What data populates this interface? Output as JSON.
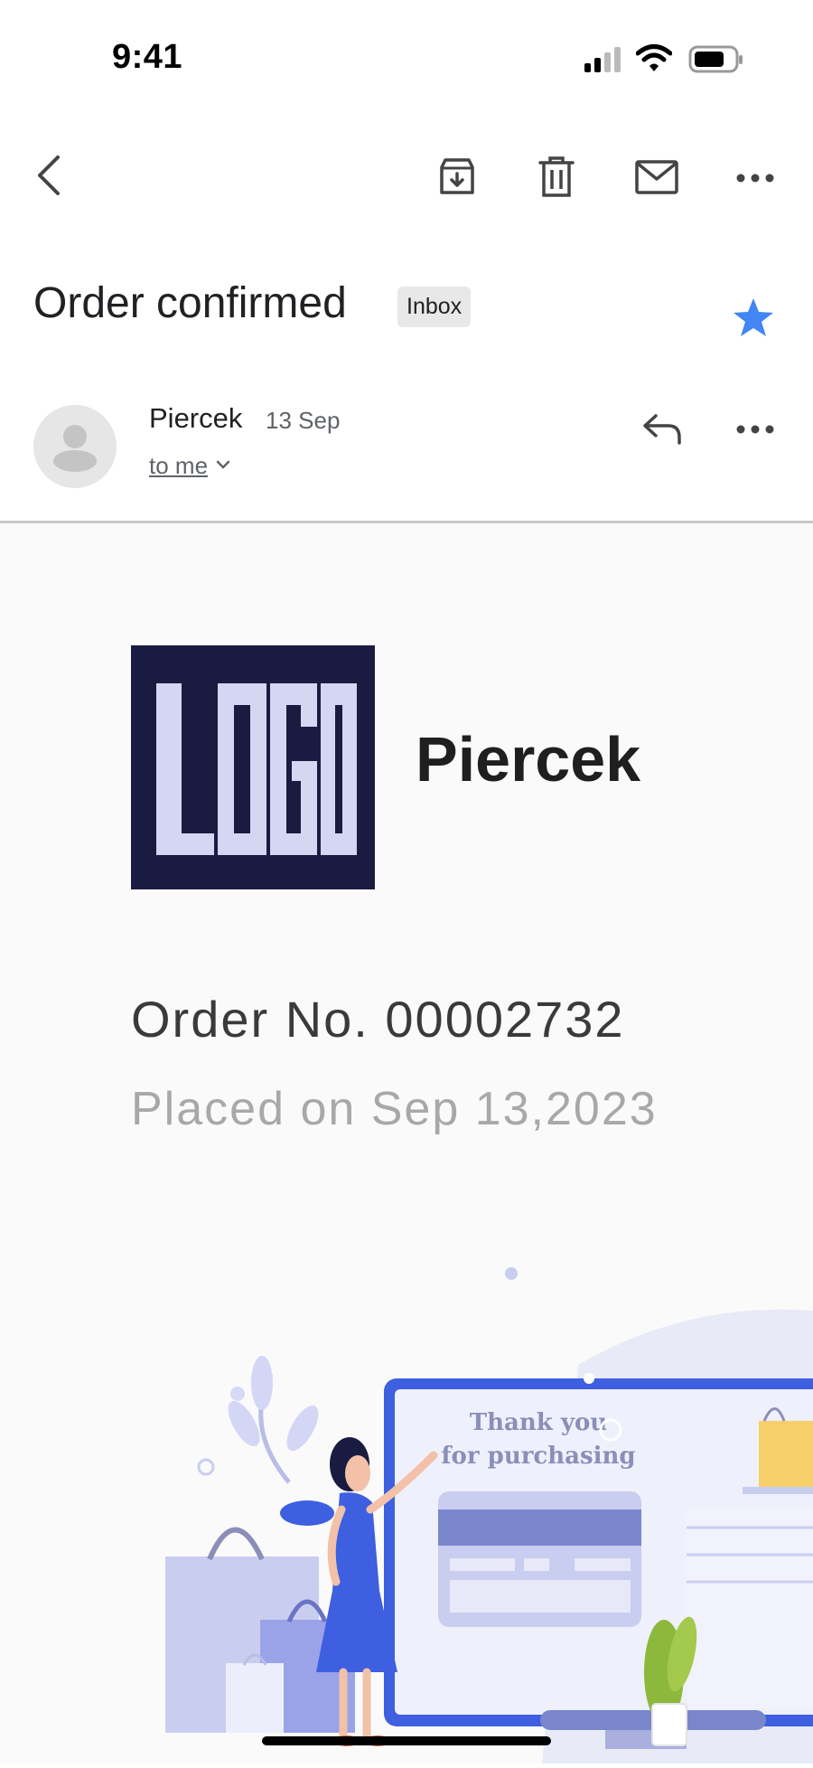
{
  "status_bar": {
    "time": "9:41"
  },
  "toolbar": {
    "back_icon": "chevron-left-icon",
    "archive_icon": "archive-icon",
    "delete_icon": "trash-icon",
    "mark_unread_icon": "mail-icon",
    "more_icon": "more-horizontal-icon"
  },
  "email": {
    "subject": "Order confirmed",
    "label": "Inbox",
    "starred": true,
    "star_color": "#4285f4",
    "sender": "Piercek",
    "date": "13 Sep",
    "recipient": "to me"
  },
  "body": {
    "logo_text": "LOGO",
    "brand_name": "Piercek",
    "order_number": "Order No. 00002732",
    "placed_on": "Placed on Sep 13,2023",
    "illustration": {
      "line1": "Thank you",
      "line2": "for purchasing"
    }
  },
  "colors": {
    "accent_blue": "#3d5fe0",
    "logo_bg": "#1a1b40",
    "illustration_lavender": "#c9cdf0"
  }
}
